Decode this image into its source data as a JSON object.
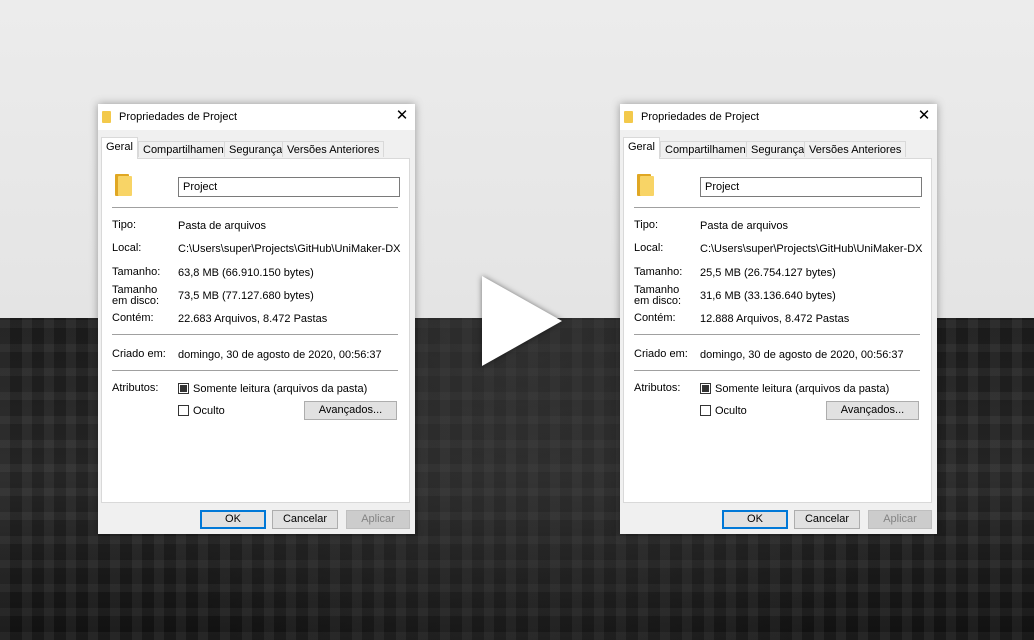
{
  "dialogs": [
    {
      "title": "Propriedades de Project",
      "close_glyph": "✕",
      "tabs": [
        "Geral",
        "Compartilhamento",
        "Segurança",
        "Versões Anteriores"
      ],
      "name_value": "Project",
      "fields": {
        "tipo_label": "Tipo:",
        "tipo_value": "Pasta de arquivos",
        "local_label": "Local:",
        "local_value": "C:\\Users\\super\\Projects\\GitHub\\UniMaker-DX",
        "tamanho_label": "Tamanho:",
        "tamanho_value": "63,8 MB (66.910.150 bytes)",
        "disco_label": "Tamanho em disco:",
        "disco_value": "73,5 MB (77.127.680 bytes)",
        "contem_label": "Contém:",
        "contem_value": "22.683 Arquivos, 8.472 Pastas",
        "criado_label": "Criado em:",
        "criado_value": "domingo, 30 de agosto de 2020, 00:56:37",
        "atributos_label": "Atributos:",
        "somente_leitura": "Somente leitura (arquivos da pasta)",
        "oculto": "Oculto",
        "avancados": "Avançados..."
      },
      "buttons": {
        "ok": "OK",
        "cancelar": "Cancelar",
        "aplicar": "Aplicar"
      }
    },
    {
      "title": "Propriedades de Project",
      "close_glyph": "✕",
      "tabs": [
        "Geral",
        "Compartilhamento",
        "Segurança",
        "Versões Anteriores"
      ],
      "name_value": "Project",
      "fields": {
        "tipo_label": "Tipo:",
        "tipo_value": "Pasta de arquivos",
        "local_label": "Local:",
        "local_value": "C:\\Users\\super\\Projects\\GitHub\\UniMaker-DX",
        "tamanho_label": "Tamanho:",
        "tamanho_value": "25,5 MB (26.754.127 bytes)",
        "disco_label": "Tamanho em disco:",
        "disco_value": "31,6 MB (33.136.640 bytes)",
        "contem_label": "Contém:",
        "contem_value": "12.888 Arquivos, 8.472 Pastas",
        "criado_label": "Criado em:",
        "criado_value": "domingo, 30 de agosto de 2020, 00:56:37",
        "atributos_label": "Atributos:",
        "somente_leitura": "Somente leitura (arquivos da pasta)",
        "oculto": "Oculto",
        "avancados": "Avançados..."
      },
      "buttons": {
        "ok": "OK",
        "cancelar": "Cancelar",
        "aplicar": "Aplicar"
      }
    }
  ],
  "arrow_icon": "play-arrow-icon"
}
